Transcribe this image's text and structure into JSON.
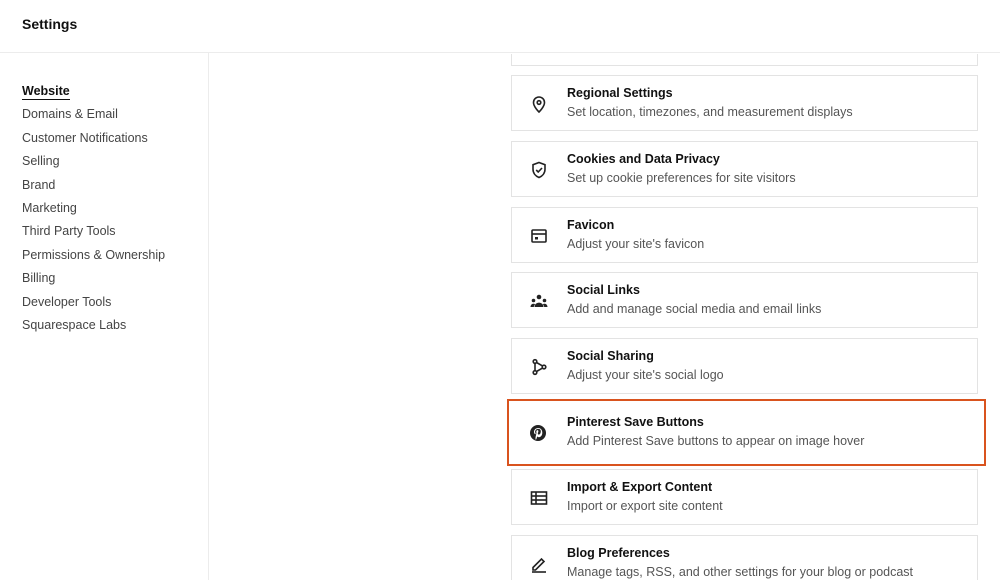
{
  "header": {
    "title": "Settings"
  },
  "sidebar": {
    "items": [
      {
        "label": "Website",
        "active": true
      },
      {
        "label": "Domains & Email"
      },
      {
        "label": "Customer Notifications"
      },
      {
        "label": "Selling"
      },
      {
        "label": "Brand"
      },
      {
        "label": "Marketing"
      },
      {
        "label": "Third Party Tools"
      },
      {
        "label": "Permissions & Ownership"
      },
      {
        "label": "Billing"
      },
      {
        "label": "Developer Tools"
      },
      {
        "label": "Squarespace Labs"
      }
    ]
  },
  "cards": [
    {
      "icon": "location-pin-icon",
      "title": "Regional Settings",
      "desc": "Set location, timezones, and measurement displays"
    },
    {
      "icon": "shield-check-icon",
      "title": "Cookies and Data Privacy",
      "desc": "Set up cookie preferences for site visitors"
    },
    {
      "icon": "browser-window-icon",
      "title": "Favicon",
      "desc": "Adjust your site's favicon"
    },
    {
      "icon": "people-group-icon",
      "title": "Social Links",
      "desc": "Add and manage social media and email links"
    },
    {
      "icon": "share-branch-icon",
      "title": "Social Sharing",
      "desc": "Adjust your site's social logo"
    },
    {
      "icon": "pinterest-icon",
      "title": "Pinterest Save Buttons",
      "desc": "Add Pinterest Save buttons to appear on image hover",
      "highlighted": true
    },
    {
      "icon": "table-list-icon",
      "title": "Import & Export Content",
      "desc": "Import or export site content"
    },
    {
      "icon": "edit-pen-icon",
      "title": "Blog Preferences",
      "desc": "Manage tags, RSS, and other settings for your blog or podcast"
    }
  ],
  "colors": {
    "highlight": "#d9531e",
    "border": "#e3e3e3"
  }
}
